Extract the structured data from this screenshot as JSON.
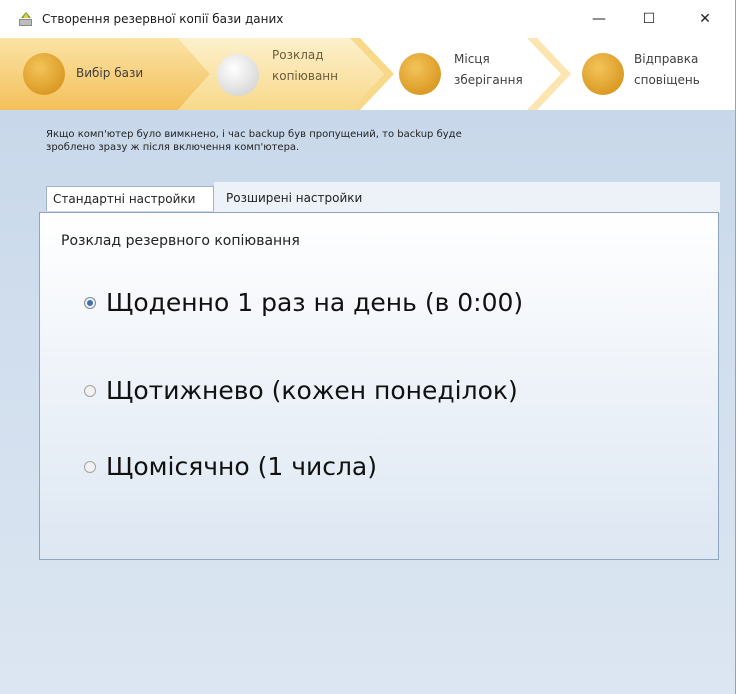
{
  "window": {
    "title": "Створення резервної копії бази даних",
    "min_glyph": "—",
    "max_glyph": "☐",
    "close_glyph": "✕"
  },
  "wizard": {
    "steps": [
      {
        "label_lines": [
          "Вибір бази"
        ],
        "state": "done"
      },
      {
        "label_lines": [
          "Розклад",
          "копіюванн"
        ],
        "state": "active"
      },
      {
        "label_lines": [
          "Місця",
          "зберігання"
        ],
        "state": "pending"
      },
      {
        "label_lines": [
          "Відправка",
          "сповіщень"
        ],
        "state": "pending"
      }
    ]
  },
  "info_text": {
    "line1": "Якщо комп'ютер було вимкнено, і час backup був пропущений, то backup буде",
    "line2": "зроблено зразу ж після включення комп'ютера."
  },
  "tabs": [
    {
      "label": "Стандартні настройки",
      "active": true
    },
    {
      "label": "Розширені настройки",
      "active": false
    }
  ],
  "schedule": {
    "title": "Розклад резервного копіювання",
    "options": [
      {
        "label": "Щоденно 1 раз на день (в 0:00)",
        "checked": true
      },
      {
        "label": "Щотижнево (кожен понеділок)",
        "checked": false
      },
      {
        "label": "Щомісячно (1 числа)",
        "checked": false
      }
    ]
  },
  "colors": {
    "step_done": "#f5c96a",
    "step_active": "#fbe3a6",
    "step_pending": "#ffffff",
    "circle_done": "#e5a52a",
    "circle_active": "#e8e8e8",
    "circle_pending": "#f0b13a",
    "accent_blue": "#3f6fb5"
  }
}
